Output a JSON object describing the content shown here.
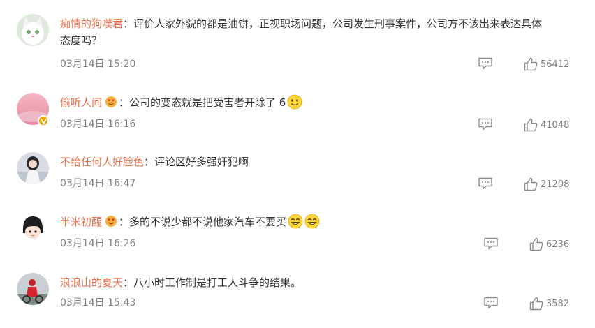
{
  "comments": [
    {
      "username": "痴情的狗噗君",
      "separator": "：",
      "text_line1": "评价人家外貌的都是油饼，正视职场问题，公司发生刑事案件，公司方不该出来表达具体",
      "text_line2": "态度吗？",
      "time": "03月14日 15:20",
      "likes": "56412"
    },
    {
      "username": "偷听人间",
      "separator": "：",
      "text_line1": "公司的变态就是把受害者开除了 6",
      "time": "03月14日 16:16",
      "likes": "41048"
    },
    {
      "username": "不给任何人好脸色",
      "separator": "：",
      "text_line1": "评论区好多强奸犯啊",
      "time": "03月14日 16:47",
      "likes": "21208"
    },
    {
      "username": "半米初醒",
      "separator": "：",
      "text_line1": "多的不说少都不说他家汽车不要买",
      "time": "03月14日 16:26",
      "likes": "6236"
    },
    {
      "username": "浪浪山的夏天",
      "separator": "：",
      "text_line1": "八小时工作制是打工人斗争的结果。",
      "time": "03月14日 15:43",
      "likes": "3582"
    }
  ],
  "colors": {
    "username": "#eb7350",
    "meta": "#808080",
    "verified_badge": "#f0a400"
  },
  "icons": {
    "reply": "comment-bubble-icon",
    "like": "thumbs-up-icon",
    "member_badge": "heart-eyes-badge-icon",
    "emoji": "smile-emoji-icon"
  }
}
